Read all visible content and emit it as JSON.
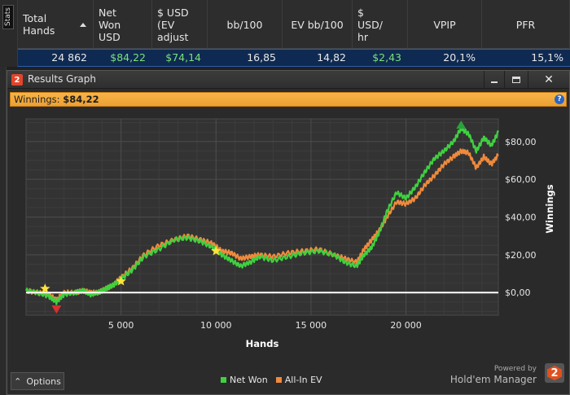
{
  "stats_panel": {
    "tab_label": "Stats"
  },
  "table": {
    "columns": [
      {
        "label": "Total\nHands",
        "width": 93,
        "sortable": true
      },
      {
        "label": "Net\nWon\nUSD",
        "width": 72
      },
      {
        "label": "$ USD\n(EV\nadjust",
        "width": 68
      },
      {
        "label": "bb/100",
        "width": 92,
        "center": true
      },
      {
        "label": "EV bb/100",
        "width": 86,
        "center": true
      },
      {
        "label": "$\nUSD/\nhr",
        "width": 68
      },
      {
        "label": "VPIP",
        "width": 91,
        "center": true
      },
      {
        "label": "PFR",
        "width": 108,
        "center": true
      }
    ],
    "row": [
      "24 862",
      "$84,22",
      "$74,14",
      "16,85",
      "14,82",
      "$2,43",
      "20,1%",
      "15,1%"
    ],
    "green_columns": [
      1,
      2,
      5
    ]
  },
  "window": {
    "app_badge": "2",
    "title": "Results Graph",
    "controls": {
      "close": "✕"
    },
    "info_label": "Winnings:",
    "info_value": "$84,22",
    "help_icon": "?"
  },
  "footer": {
    "options_label": "Options",
    "options_icon": "⌃",
    "powered_by": "Powered by",
    "brand_name": "Hold'em Manager",
    "brand_badge": "2"
  },
  "chart_data": {
    "type": "line",
    "xlabel": "Hands",
    "ylabel": "Winnings",
    "xlim": [
      0,
      24862
    ],
    "ylim": [
      -12,
      92
    ],
    "x_ticks": [
      5000,
      10000,
      15000,
      20000
    ],
    "x_tick_labels": [
      "5 000",
      "10 000",
      "15 000",
      "20 000"
    ],
    "y_ticks": [
      0,
      20,
      40,
      60,
      80
    ],
    "y_tick_labels": [
      "$0,00",
      "$20,00",
      "$40,00",
      "$60,00",
      "$80,00"
    ],
    "grid": true,
    "legend_position": "bottom-center",
    "colors": {
      "net_won": "#3fd13f",
      "all_in_ev": "#f08a3c",
      "zero_line": "#ffffff"
    },
    "series": [
      {
        "name": "Net Won",
        "x": [
          0,
          600,
          1200,
          1600,
          2000,
          2600,
          3000,
          3400,
          3800,
          4200,
          4600,
          5000,
          5600,
          6200,
          7000,
          7800,
          8500,
          9200,
          9800,
          10300,
          10800,
          11300,
          11800,
          12300,
          13000,
          13800,
          14600,
          15400,
          16200,
          16800,
          17400,
          17800,
          18200,
          18600,
          19000,
          19500,
          20000,
          20500,
          21000,
          21500,
          22000,
          22500,
          22900,
          23300,
          23700,
          24100,
          24500,
          24862
        ],
        "y": [
          1,
          0,
          -2,
          -5,
          -1,
          0,
          1,
          -1,
          0,
          2,
          4,
          7,
          12,
          19,
          23,
          28,
          29,
          27,
          24,
          20,
          17,
          14,
          16,
          19,
          17,
          19,
          21,
          22,
          20,
          16,
          14,
          20,
          24,
          32,
          43,
          53,
          50,
          56,
          64,
          71,
          75,
          80,
          87,
          84,
          75,
          82,
          78,
          85
        ]
      },
      {
        "name": "All-In EV",
        "x": [
          0,
          600,
          1200,
          1600,
          2000,
          2600,
          3000,
          3400,
          3800,
          4200,
          4600,
          5000,
          5600,
          6200,
          7000,
          7800,
          8500,
          9200,
          9800,
          10300,
          10800,
          11300,
          11800,
          12300,
          13000,
          13800,
          14600,
          15400,
          16200,
          16800,
          17400,
          17800,
          18200,
          18600,
          19000,
          19500,
          20000,
          20500,
          21000,
          21500,
          22000,
          22500,
          22900,
          23300,
          23700,
          24100,
          24500,
          24862
        ],
        "y": [
          1,
          0,
          -1,
          -4,
          0,
          0,
          1,
          0,
          0,
          2,
          4,
          8,
          13,
          20,
          25,
          28,
          30,
          28,
          26,
          22,
          21,
          18,
          19,
          20,
          19,
          21,
          22,
          23,
          20,
          18,
          16,
          23,
          28,
          33,
          40,
          48,
          47,
          50,
          57,
          62,
          68,
          72,
          75,
          74,
          66,
          72,
          68,
          73
        ]
      }
    ],
    "markers": [
      {
        "type": "star",
        "x": 1000,
        "y": 2,
        "color": "#ffe23a"
      },
      {
        "type": "star",
        "x": 5000,
        "y": 6,
        "color": "#ffe23a"
      },
      {
        "type": "star",
        "x": 10000,
        "y": 22,
        "color": "#ffe23a"
      },
      {
        "type": "triangle-down",
        "x": 1600,
        "y": -9,
        "color": "#d83030"
      },
      {
        "type": "triangle-up",
        "x": 22900,
        "y": 89,
        "color": "#2aa23a"
      }
    ]
  }
}
